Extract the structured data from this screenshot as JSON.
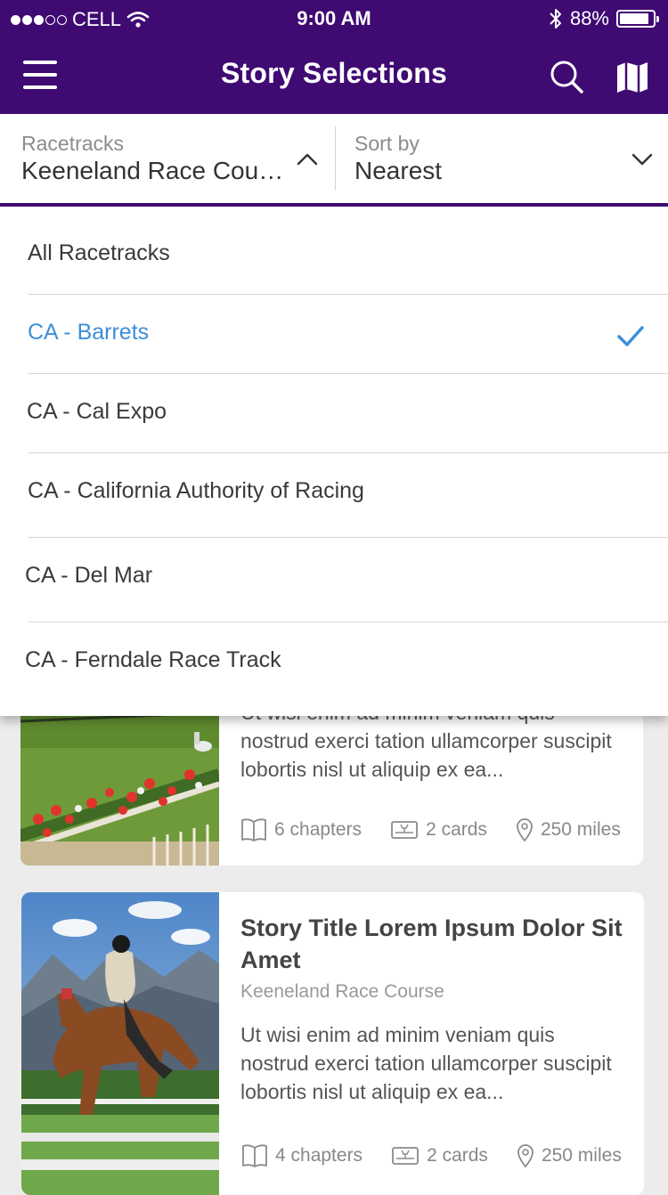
{
  "status": {
    "carrier": "CELL",
    "time": "9:00 AM",
    "battery": "88%",
    "battery_level": 0.88
  },
  "header": {
    "title": "Story Selections"
  },
  "filters": {
    "racetrack_label": "Racetracks",
    "racetrack_value": "Keeneland Race Course",
    "sort_label": "Sort by",
    "sort_value": "Nearest"
  },
  "dropdown": {
    "options": [
      {
        "label": "All Racetracks",
        "selected": false
      },
      {
        "label": "CA - Barrets",
        "selected": true
      },
      {
        "label": "CA - Cal Expo",
        "selected": false
      },
      {
        "label": "CA - California Authority of Racing",
        "selected": false
      },
      {
        "label": "CA - Del Mar",
        "selected": false
      },
      {
        "label": "CA - Ferndale Race Track",
        "selected": false
      }
    ]
  },
  "cards": [
    {
      "desc_partial": "Ut wisi enim ad minim veniam quis",
      "desc_rest": "nostrud exerci tation ullamcorper suscipit lobortis nisl ut aliquip ex ea...",
      "chapters": "6 chapters",
      "cards": "2 cards",
      "distance": "250 miles"
    },
    {
      "title": "Story Title Lorem Ipsum Dolor Sit Amet",
      "location": "Keeneland Race Course",
      "desc": "Ut wisi enim ad minim veniam quis nostrud exerci tation ullamcorper suscipit lobortis nisl ut aliquip ex ea...",
      "chapters": "4 chapters",
      "cards": "2 cards",
      "distance": "250 miles"
    }
  ],
  "colors": {
    "brand": "#3f0a72",
    "selected": "#3d8fd8",
    "background": "#ececec"
  }
}
